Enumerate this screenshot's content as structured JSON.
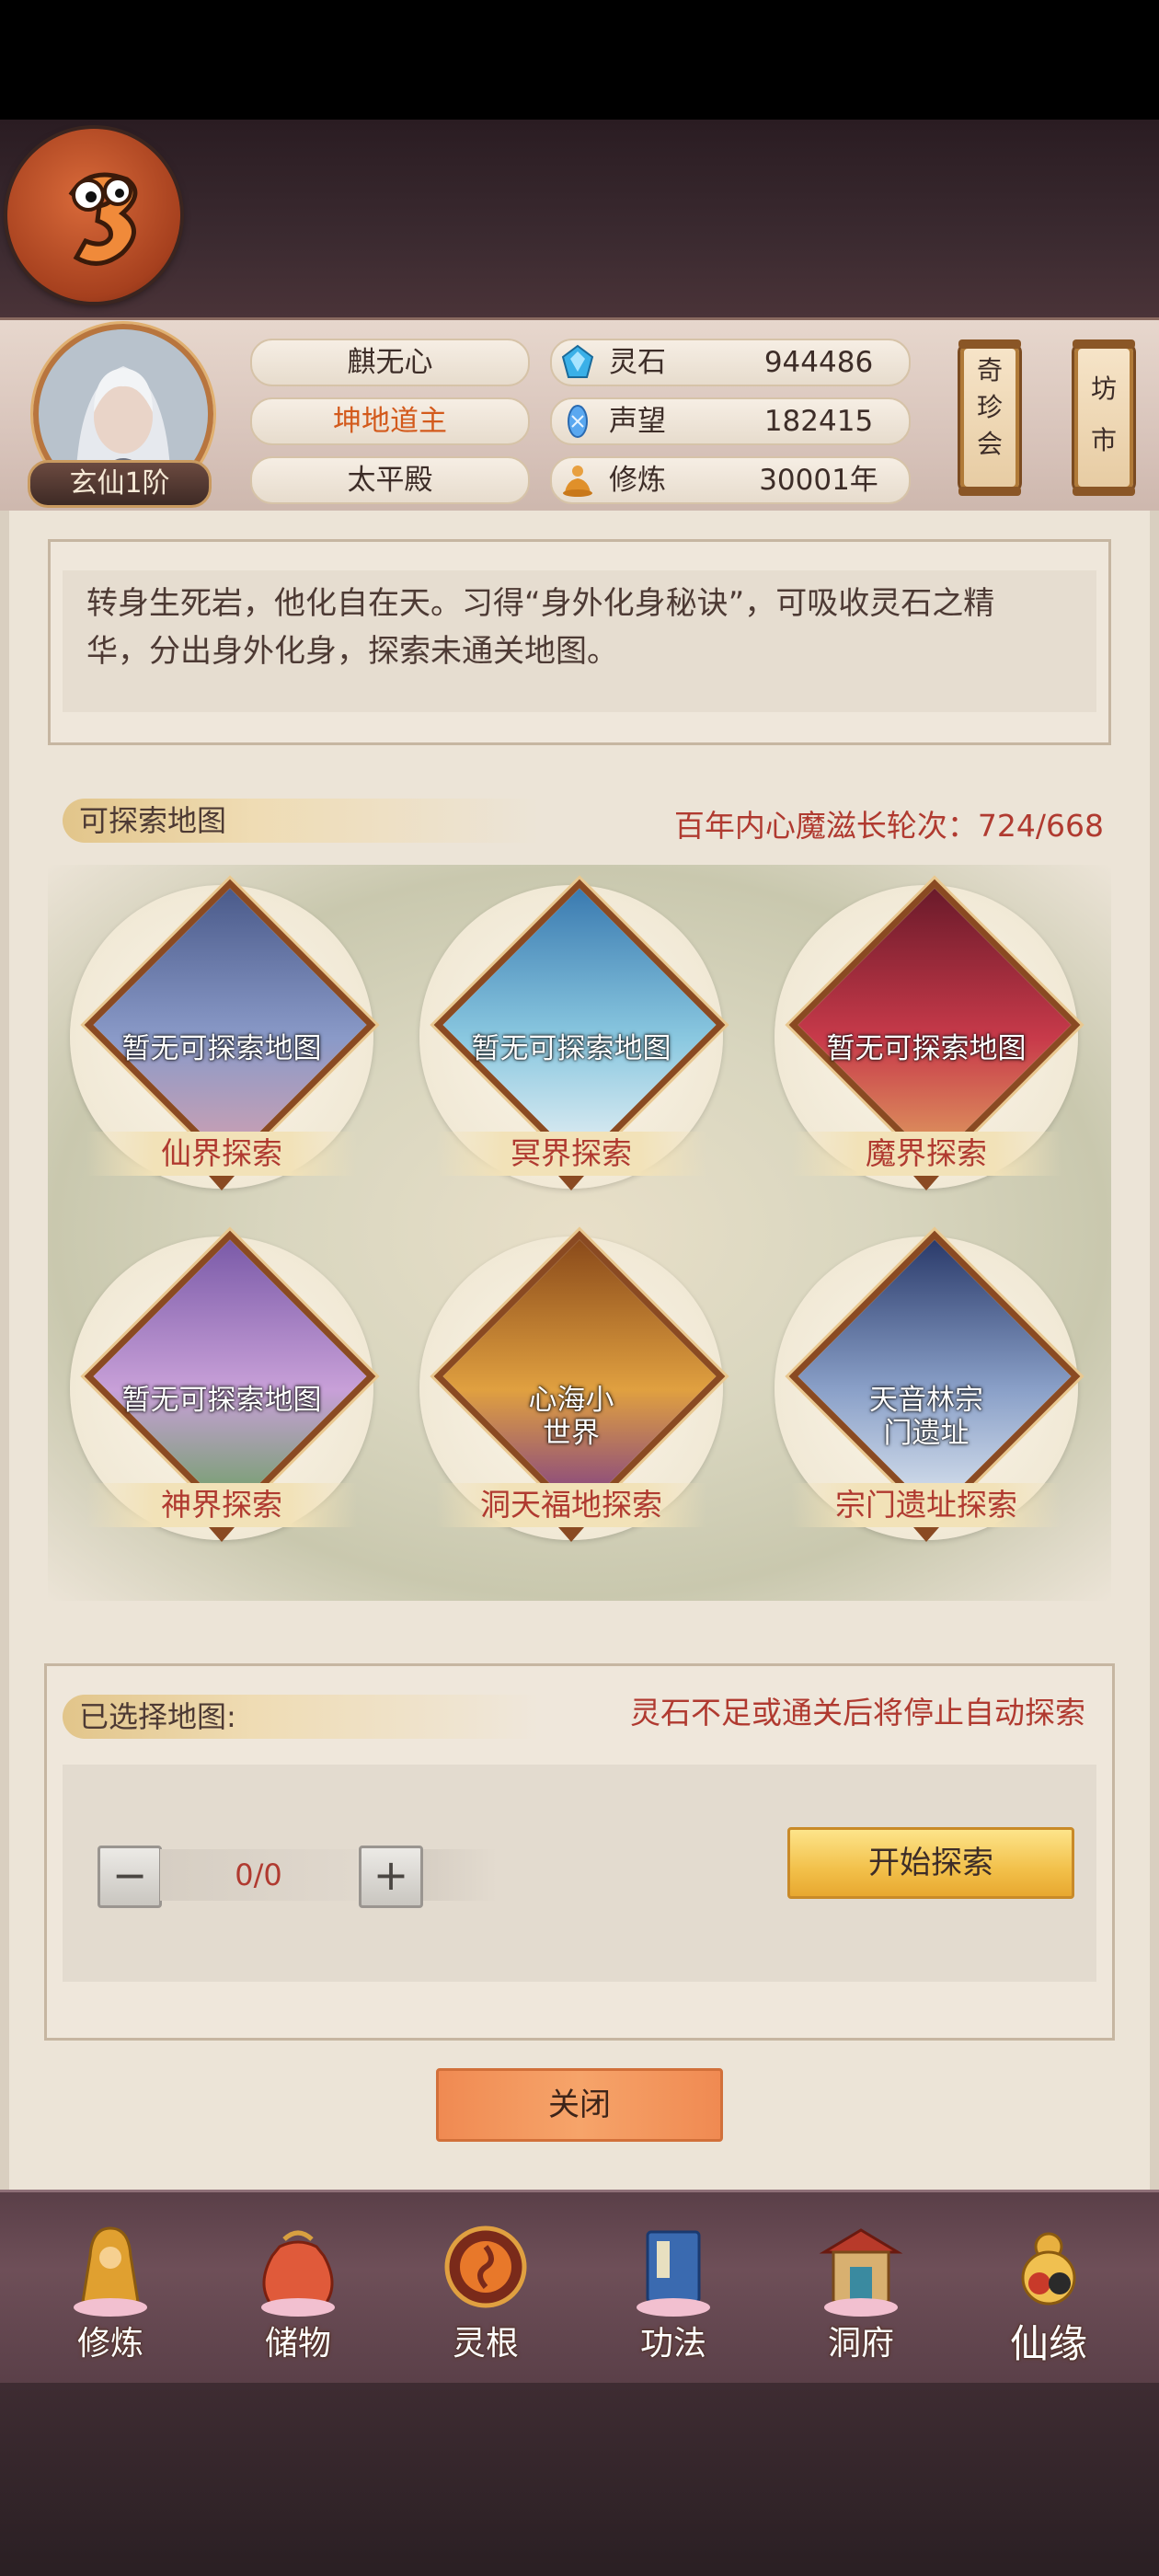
{
  "header": {
    "rank": "玄仙1阶",
    "name": "麒无心",
    "title": "坤地道主",
    "sect": "太平殿",
    "resources": [
      {
        "label": "灵石",
        "value": "944486",
        "icon": "spirit-stone-icon"
      },
      {
        "label": "声望",
        "value": "182415",
        "icon": "reputation-icon"
      },
      {
        "label": "修炼",
        "value": "30001年",
        "icon": "meditation-icon"
      }
    ],
    "side_buttons": [
      {
        "label": "奇珍会"
      },
      {
        "label": "坊市"
      }
    ]
  },
  "description": "转身生死岩，他化自在天。习得“身外化身秘诀”，可吸收灵石之精华，分出身外化身，探索未通关地图。",
  "explorable": {
    "tab_label": "可探索地图",
    "cycle_text": "百年内心魔滋长轮次：724/668",
    "maps": [
      {
        "label": "仙界探索",
        "note": "暂无可探索地图",
        "colors": [
          "#4a5a8a",
          "#8a9ac8",
          "#d3a0b0"
        ]
      },
      {
        "label": "冥界探索",
        "note": "暂无可探索地图",
        "colors": [
          "#3a7ab0",
          "#8ac8e0",
          "#e8f0f4"
        ]
      },
      {
        "label": "魔界探索",
        "note": "暂无可探索地图",
        "colors": [
          "#6a1a2a",
          "#c83a4a",
          "#e0a060"
        ]
      },
      {
        "label": "神界探索",
        "note": "暂无可探索地图",
        "colors": [
          "#7a5aa8",
          "#c8a0d8",
          "#6aa060"
        ]
      },
      {
        "label": "洞天福地探索",
        "note": "心海小世界",
        "colors": [
          "#8a4a1a",
          "#e0a040",
          "#7a3a8a"
        ]
      },
      {
        "label": "宗门遗址探索",
        "note": "天音林宗门遗址",
        "colors": [
          "#2a3a6a",
          "#8aa0c8",
          "#dde6f0"
        ]
      }
    ]
  },
  "selected": {
    "tab_label": "已选择地图:",
    "stop_note": "灵石不足或通关后将停止自动探索",
    "count": "0/0",
    "minus": "−",
    "plus": "+",
    "start_label": "开始探索"
  },
  "close_label": "关闭",
  "bottom_nav": [
    {
      "label": "修炼",
      "icon": "cultivation-icon"
    },
    {
      "label": "储物",
      "icon": "storage-bag-icon"
    },
    {
      "label": "灵根",
      "icon": "spirit-root-icon"
    },
    {
      "label": "功法",
      "icon": "technique-book-icon"
    },
    {
      "label": "洞府",
      "icon": "cave-dwelling-icon"
    },
    {
      "label": "仙缘",
      "icon": "immortal-fate-icon"
    }
  ]
}
